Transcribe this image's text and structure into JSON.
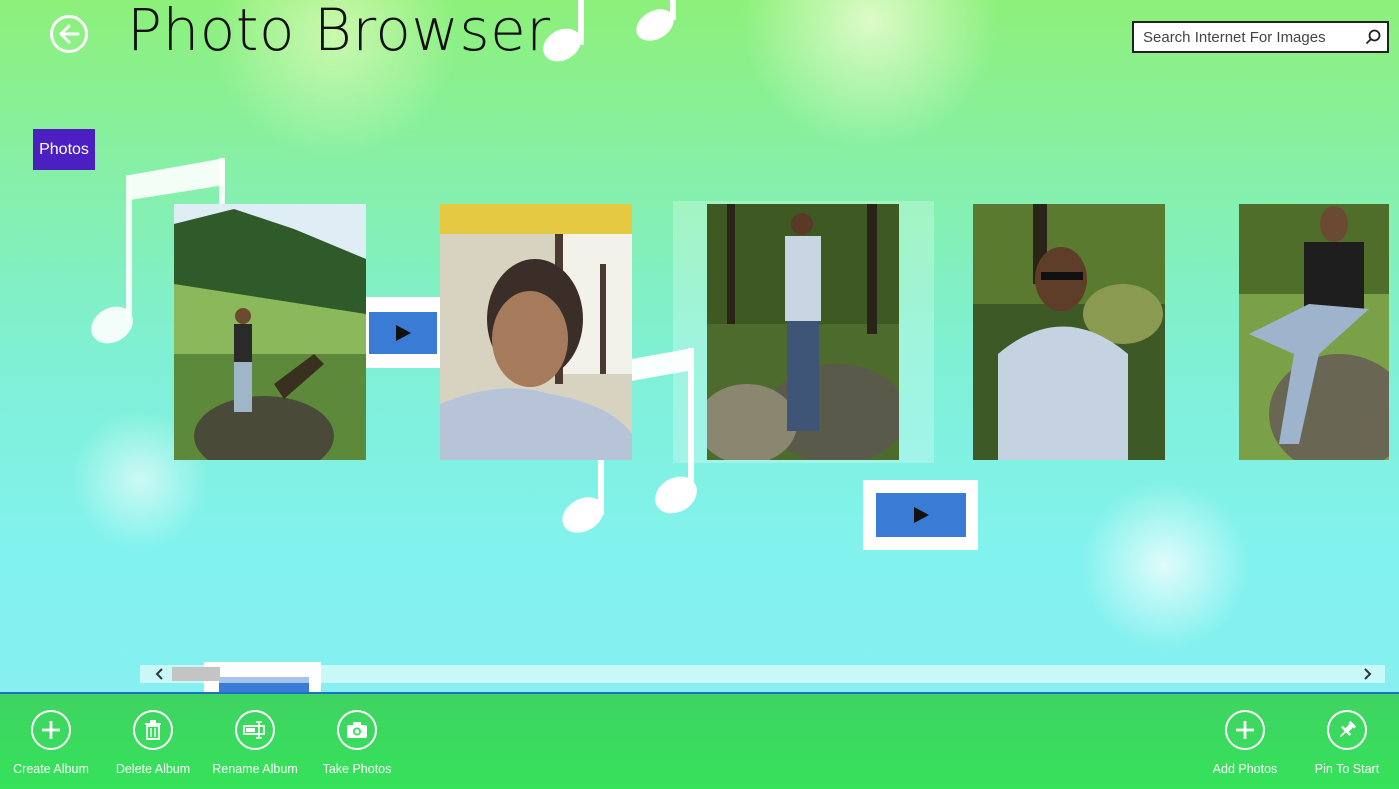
{
  "header": {
    "back_icon": "back-arrow-icon",
    "title": "Photo Browser"
  },
  "search": {
    "placeholder": "Search Internet For Images",
    "icon": "search-icon"
  },
  "group": {
    "label": "Photos"
  },
  "tiles": [
    {
      "type": "photo",
      "scene": "man on rock in green valley with mountains"
    },
    {
      "type": "video",
      "icon": "play-icon"
    },
    {
      "type": "photo",
      "scene": "man in bus window profile"
    },
    {
      "type": "photo",
      "scene": "man standing in forest on rocks"
    },
    {
      "type": "photo",
      "scene": "man with sunglasses in forest"
    },
    {
      "type": "photo",
      "scene": "man sitting on rock"
    },
    {
      "type": "video",
      "icon": "play-icon"
    }
  ],
  "scrollbar": {
    "left_icon": "chevron-left-icon",
    "right_icon": "chevron-right-icon",
    "position": 0.04
  },
  "appbar": {
    "left_buttons": [
      {
        "label": "Create Album",
        "icon": "plus-icon"
      },
      {
        "label": "Delete Album",
        "icon": "trash-icon"
      },
      {
        "label": "Rename Album",
        "icon": "rename-icon"
      },
      {
        "label": "Take Photos",
        "icon": "camera-icon"
      }
    ],
    "right_buttons": [
      {
        "label": "Add Photos",
        "icon": "plus-icon"
      },
      {
        "label": "Pin To Start",
        "icon": "pin-icon"
      }
    ]
  },
  "colors": {
    "group_label_bg": "#4c1fc1",
    "video_button": "#3a7bd5",
    "appbar_bg": "#35e25a"
  }
}
